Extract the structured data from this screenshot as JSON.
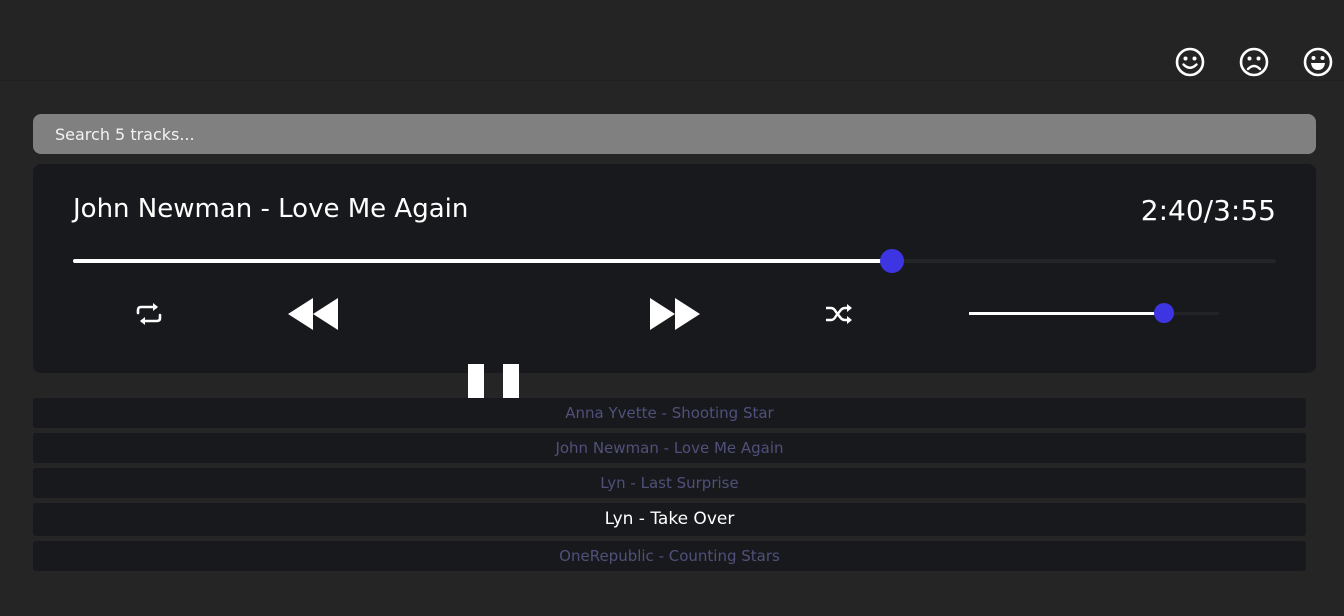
{
  "header": {
    "mood_buttons": [
      {
        "name": "happy",
        "icon": "smile-icon"
      },
      {
        "name": "sad",
        "icon": "frown-icon"
      },
      {
        "name": "excited",
        "icon": "grin-icon"
      }
    ]
  },
  "search": {
    "placeholder": "Search 5 tracks...",
    "value": ""
  },
  "player": {
    "current_track": "John Newman - Love Me Again",
    "elapsed": "2:40",
    "separator": "/",
    "duration": "3:55",
    "progress_fraction": 0.681,
    "volume_fraction": 0.78,
    "controls": {
      "repeat_icon": "repeat-icon",
      "rewind_icon": "rewind-icon",
      "pause_icon": "pause-icon",
      "forward_icon": "fast-forward-icon",
      "shuffle_icon": "shuffle-icon"
    },
    "accent_color": "#3d35e2"
  },
  "playlist": {
    "tracks": [
      {
        "label": "Anna Yvette - Shooting Star",
        "active": false
      },
      {
        "label": "John Newman - Love Me Again",
        "active": false
      },
      {
        "label": "Lyn - Last Surprise",
        "active": false
      },
      {
        "label": "Lyn - Take Over",
        "active": true
      },
      {
        "label": "OneRepublic - Counting Stars",
        "active": false
      }
    ]
  }
}
